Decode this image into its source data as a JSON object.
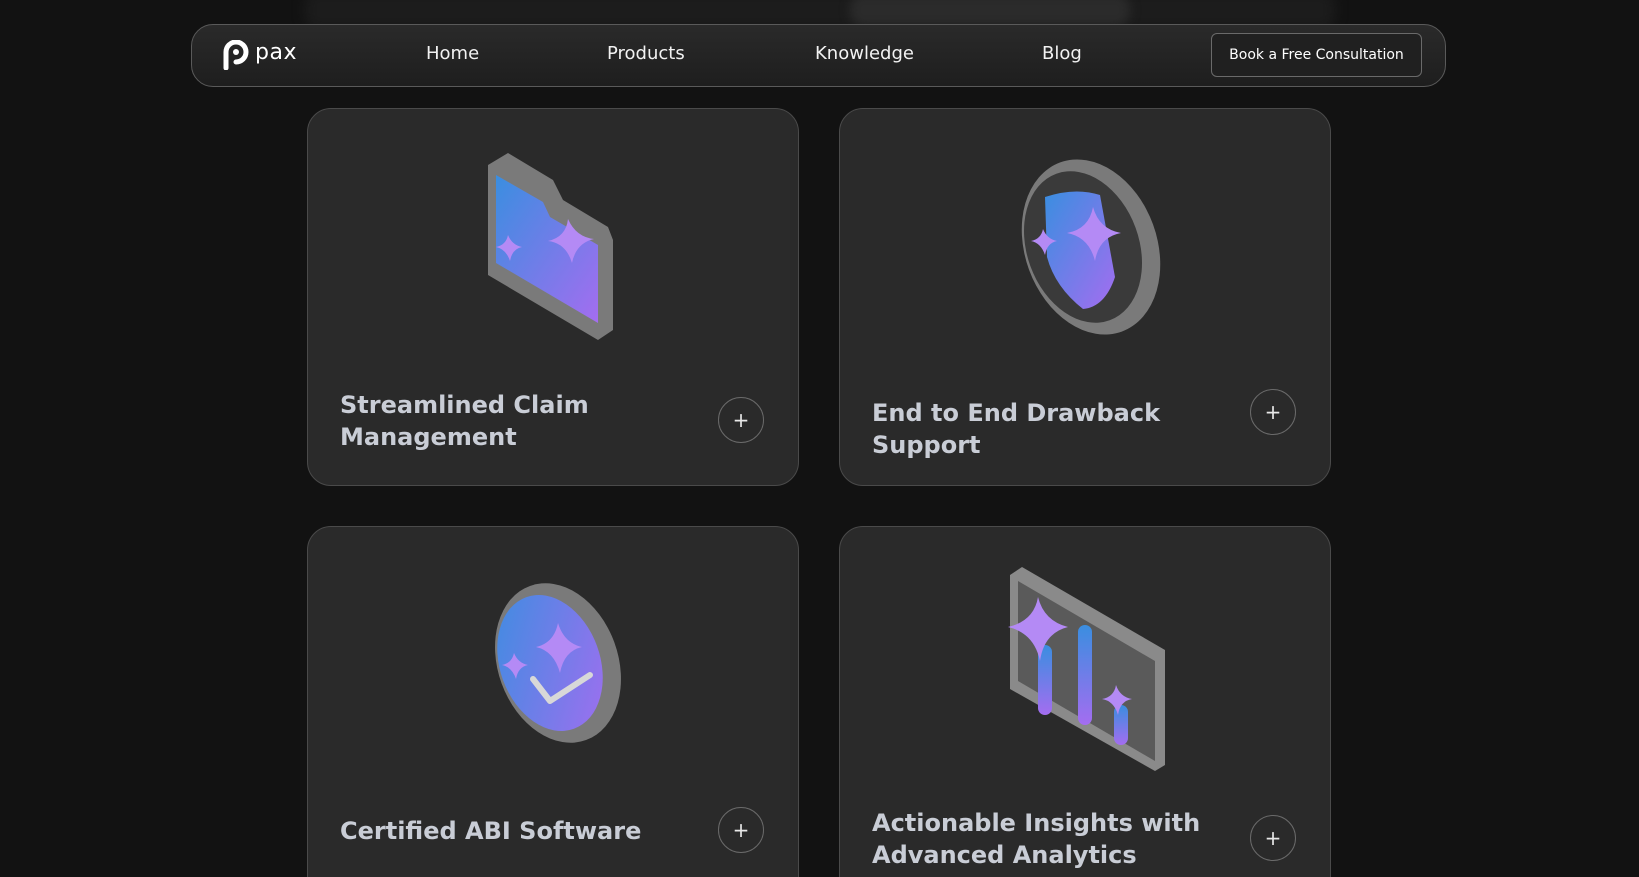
{
  "nav": {
    "logo_text": "pax",
    "links": [
      {
        "label": "Home"
      },
      {
        "label": "Products"
      },
      {
        "label": "Knowledge"
      },
      {
        "label": "Blog"
      }
    ],
    "cta_label": "Book a Free Consultation"
  },
  "cards": [
    {
      "title": "Streamlined Claim Management",
      "icon": "folder-sparkle-icon",
      "action_icon": "plus-icon",
      "action_symbol": "+"
    },
    {
      "title": "End to End Drawback Support",
      "icon": "shield-sparkle-icon",
      "action_icon": "plus-icon",
      "action_symbol": "+"
    },
    {
      "title": "Certified ABI Software",
      "icon": "badge-check-sparkle-icon",
      "action_icon": "plus-icon",
      "action_symbol": "+"
    },
    {
      "title": "Actionable Insights with Advanced Analytics",
      "icon": "analytics-sparkle-icon",
      "action_icon": "plus-icon",
      "action_symbol": "+"
    }
  ],
  "colors": {
    "background": "#121212",
    "card": "#2a2a2a",
    "card_title": "#c9cdd6",
    "accent_blue": "#3a8ee0",
    "accent_purple": "#a46df0"
  }
}
